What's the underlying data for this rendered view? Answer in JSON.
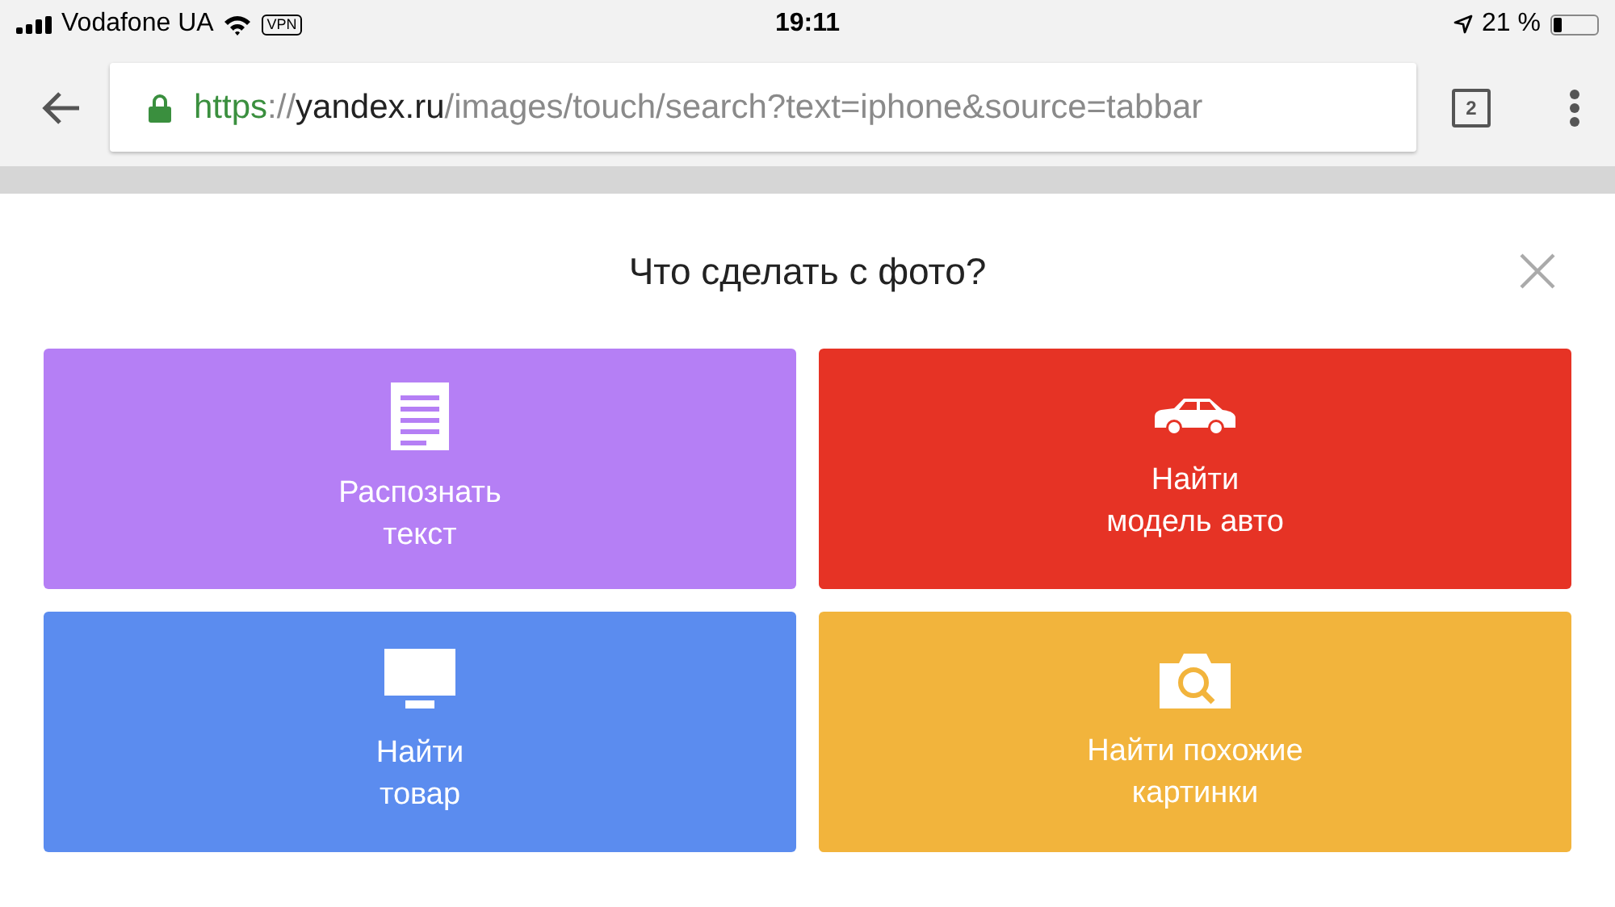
{
  "status_bar": {
    "carrier": "Vodafone UA",
    "vpn": "VPN",
    "time": "19:11",
    "battery_percent": "21 %",
    "battery": {
      "level": 0.21
    }
  },
  "toolbar": {
    "url": {
      "scheme": "https",
      "separator": "://",
      "host": "yandex.ru",
      "path": "/images/touch/search?text=iphone&source=tabbar"
    },
    "tab_count": "2"
  },
  "dialog": {
    "title": "Что сделать с фото?",
    "actions": [
      {
        "kind": "text",
        "lines": [
          "Распознать",
          "текст"
        ],
        "color": "#b57ff5"
      },
      {
        "kind": "car",
        "lines": [
          "Найти",
          "модель авто"
        ],
        "color": "#e63325"
      },
      {
        "kind": "monitor",
        "lines": [
          "Найти",
          "товар"
        ],
        "color": "#5b8cef"
      },
      {
        "kind": "camera",
        "lines": [
          "Найти похожие",
          "картинки"
        ],
        "color": "#f2b43c"
      }
    ]
  }
}
